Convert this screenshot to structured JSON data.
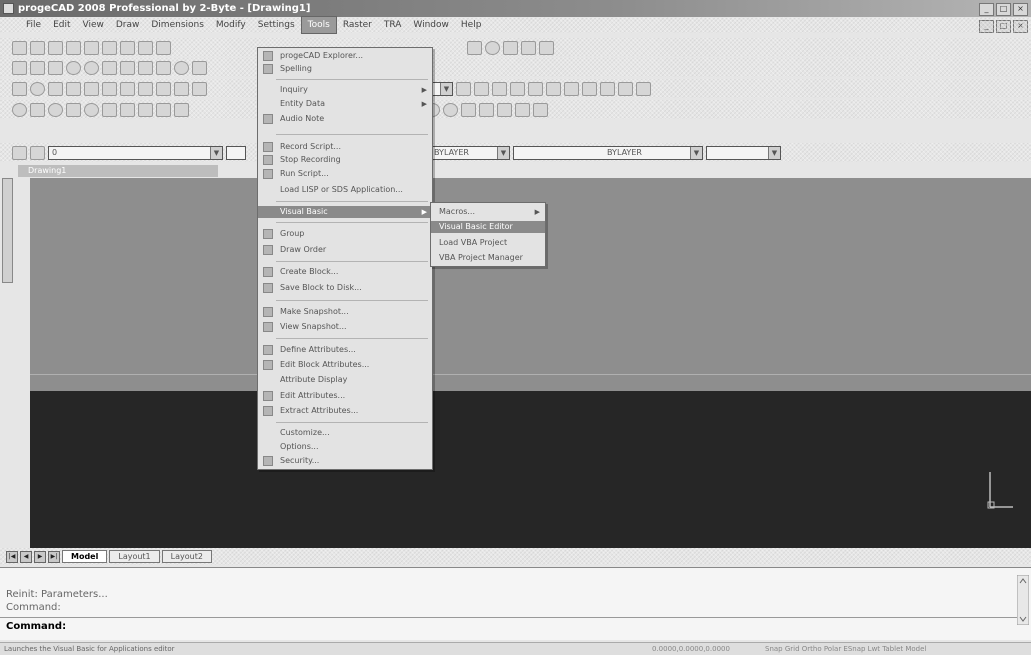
{
  "window": {
    "title": "progeCAD 2008 Professional by 2-Byte - [Drawing1]",
    "controls": [
      "_",
      "□",
      "×"
    ]
  },
  "menubar": {
    "items": [
      {
        "label": "File"
      },
      {
        "label": "Edit"
      },
      {
        "label": "View"
      },
      {
        "label": "Draw"
      },
      {
        "label": "Dimensions"
      },
      {
        "label": "Modify"
      },
      {
        "label": "Settings"
      },
      {
        "label": "Tools"
      },
      {
        "label": "Raster"
      },
      {
        "label": "TRA"
      },
      {
        "label": "Window"
      },
      {
        "label": "Help"
      }
    ]
  },
  "toolbar": {
    "layer_combo": "0",
    "layer_combo2": "BYLAYER",
    "linetype_combo": "BYLAYER"
  },
  "drawing": {
    "tab_label": "Drawing1"
  },
  "tools_menu": {
    "items": [
      {
        "label": "progeCAD Explorer..."
      },
      {
        "label": "Spelling"
      },
      {
        "label": "Inquiry",
        "sub": "▶"
      },
      {
        "label": "Entity Data",
        "sub": "▶"
      },
      {
        "label": "Audio Note"
      },
      {
        "label": "Record Script..."
      },
      {
        "label": "Stop Recording"
      },
      {
        "label": "Run Script..."
      },
      {
        "label": "Load LISP or SDS Application..."
      },
      {
        "label": "Visual Basic",
        "sub": "▶"
      },
      {
        "label": "Group"
      },
      {
        "label": "Draw Order"
      },
      {
        "label": "Create Block..."
      },
      {
        "label": "Save Block to Disk..."
      },
      {
        "label": "Make Snapshot..."
      },
      {
        "label": "View Snapshot..."
      },
      {
        "label": "Define Attributes..."
      },
      {
        "label": "Edit Block Attributes..."
      },
      {
        "label": "Attribute Display"
      },
      {
        "label": "Edit Attributes..."
      },
      {
        "label": "Extract Attributes..."
      },
      {
        "label": "Customize..."
      },
      {
        "label": "Options..."
      },
      {
        "label": "Security..."
      }
    ]
  },
  "vb_submenu": {
    "items": [
      {
        "label": "Macros...",
        "sub": "▶"
      },
      {
        "label": "Visual Basic Editor"
      },
      {
        "label": "Load VBA Project"
      },
      {
        "label": "VBA Project Manager"
      }
    ]
  },
  "layout_tabs": {
    "nav": [
      "|◀",
      "◀",
      "▶",
      "▶|"
    ],
    "tabs": [
      {
        "label": "Model"
      },
      {
        "label": "Layout1"
      },
      {
        "label": "Layout2"
      }
    ]
  },
  "command": {
    "line1": "Reinit: Parameters...",
    "line2": "Command:",
    "line3": "Command:"
  },
  "status": {
    "text": "Launches the Visual Basic for Applications editor",
    "coords": "0.0000,0.0000,0.0000",
    "modes": "Snap  Grid  Ortho  Polar  ESnap  Lwt  Tablet  Model"
  },
  "colors": {
    "titlebar": "#7a7a7a",
    "canvas_top": "#8e8e8e",
    "canvas_bottom": "#262626",
    "menu_highlight": "#8a8a8a"
  }
}
